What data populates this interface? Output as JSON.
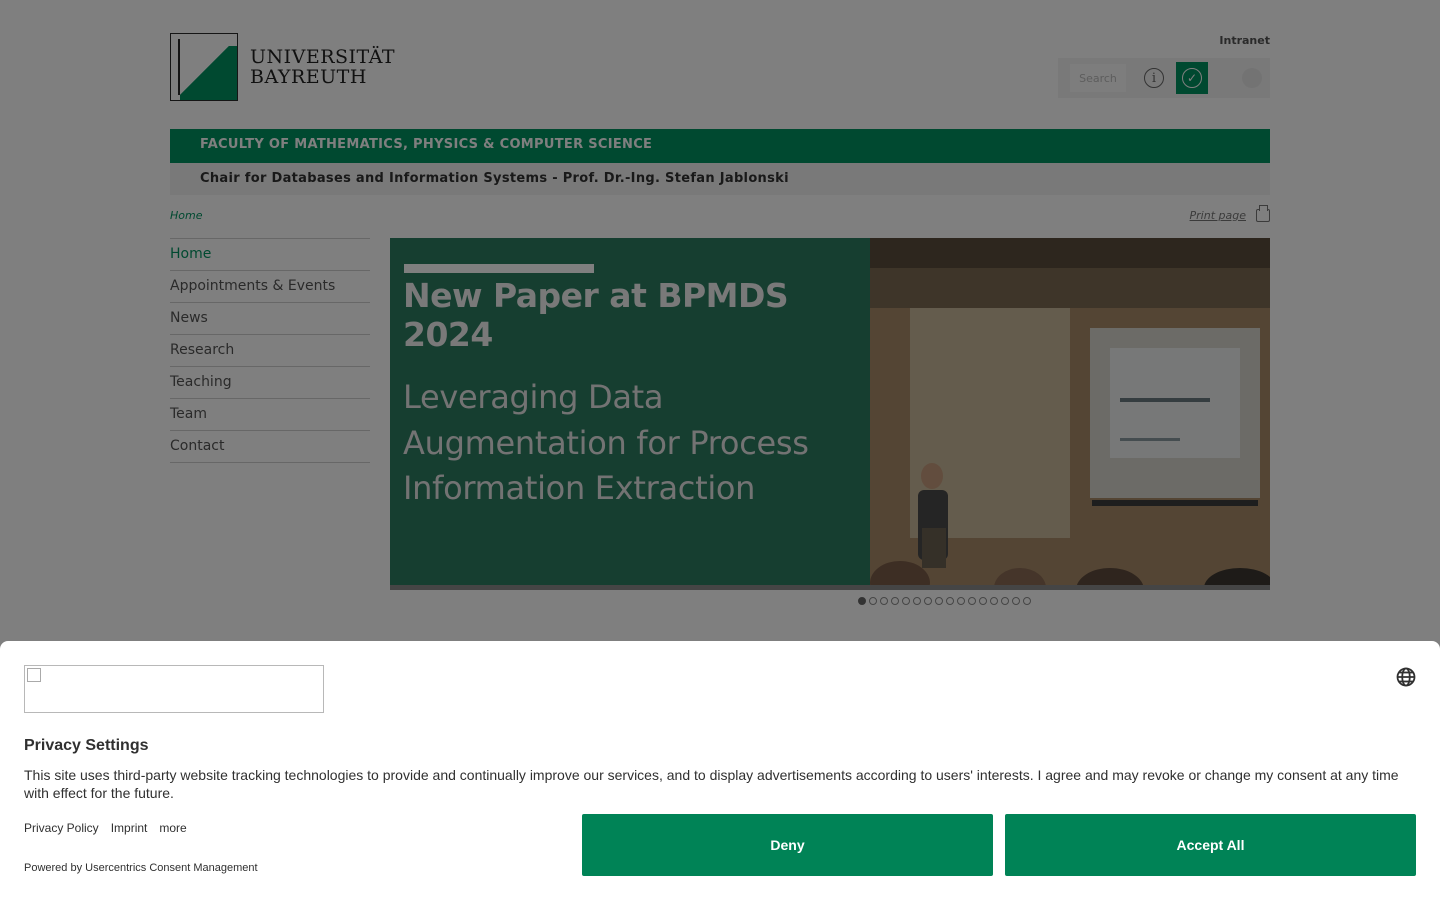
{
  "header": {
    "logo_line1": "UNIVERSITÄT",
    "logo_line2": "BAYREUTH",
    "intranet": "Intranet",
    "search_placeholder": "Search"
  },
  "faculty": "FACULTY OF MATHEMATICS, PHYSICS & COMPUTER SCIENCE",
  "chair": "Chair for Databases and Information Systems - Prof. Dr.-Ing. Stefan Jablonski",
  "breadcrumb": "Home",
  "print_label": "Print page",
  "nav": {
    "items": [
      {
        "label": "Home",
        "active": true
      },
      {
        "label": "Appointments & Events"
      },
      {
        "label": "News"
      },
      {
        "label": "Research"
      },
      {
        "label": "Teaching"
      },
      {
        "label": "Team"
      },
      {
        "label": "Contact"
      }
    ]
  },
  "hero": {
    "title": "New Paper at BPMDS 2024",
    "line1": "Leveraging Data",
    "line2": "Augmentation for Process",
    "line3": "Information Extraction",
    "slide_count": 16,
    "active_slide": 1
  },
  "consent": {
    "title": "Privacy Settings",
    "text": "This site uses third-party website tracking technologies to provide and continually improve our services, and to display advertisements according to users' interests. I agree and may revoke or change my consent at any time with effect for the future.",
    "links": [
      "Privacy Policy",
      "Imprint",
      "more"
    ],
    "powered": "Powered by Usercentrics Consent Management",
    "deny": "Deny",
    "accept": "Accept All"
  },
  "colors": {
    "brand_green": "#009260",
    "hero_green": "#2c7c61",
    "button_green": "#008356"
  }
}
